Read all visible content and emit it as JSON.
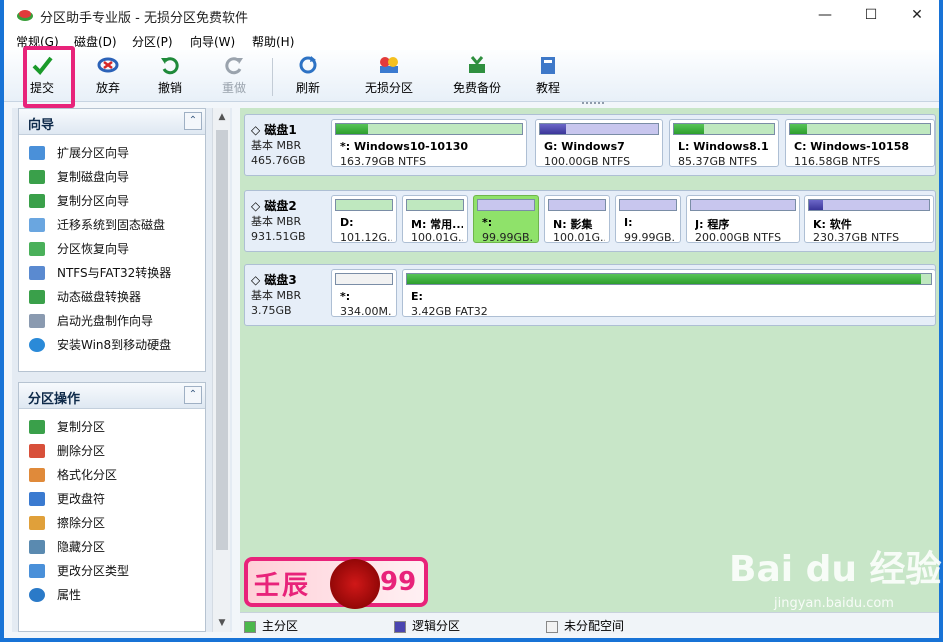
{
  "window": {
    "title": "分区助手专业版 - 无损分区免费软件",
    "minimize": "—",
    "maximize": "☐",
    "close": "✕"
  },
  "menu": [
    "常规(G)",
    "磁盘(D)",
    "分区(P)",
    "向导(W)",
    "帮助(H)"
  ],
  "toolbar": [
    {
      "label": "提交",
      "icon": "check-icon",
      "enabled": true
    },
    {
      "label": "放弃",
      "icon": "discard-icon",
      "enabled": true
    },
    {
      "label": "撤销",
      "icon": "undo-icon",
      "enabled": true
    },
    {
      "label": "重做",
      "icon": "redo-icon",
      "enabled": false
    },
    {
      "label": "刷新",
      "icon": "refresh-icon",
      "enabled": true
    },
    {
      "label": "无损分区",
      "icon": "partition-icon",
      "enabled": true
    },
    {
      "label": "免费备份",
      "icon": "backup-icon",
      "enabled": true
    },
    {
      "label": "教程",
      "icon": "tutorial-icon",
      "enabled": true
    }
  ],
  "wizard_panel": {
    "title": "向导",
    "items": [
      "扩展分区向导",
      "复制磁盘向导",
      "复制分区向导",
      "迁移系统到固态磁盘",
      "分区恢复向导",
      "NTFS与FAT32转换器",
      "动态磁盘转换器",
      "启动光盘制作向导",
      "安装Win8到移动硬盘"
    ]
  },
  "ops_panel": {
    "title": "分区操作",
    "items": [
      "复制分区",
      "删除分区",
      "格式化分区",
      "更改盘符",
      "擦除分区",
      "隐藏分区",
      "更改分区类型",
      "属性"
    ]
  },
  "disks": [
    {
      "name": "磁盘1",
      "type": "基本 MBR",
      "size": "465.76GB",
      "partitions": [
        {
          "name": "*: Windows10-10130",
          "size": "163.79GB NTFS",
          "kind": "primary",
          "used": 0.17
        },
        {
          "name": "G: Windows7",
          "size": "100.00GB NTFS",
          "kind": "logical",
          "used": 0.22
        },
        {
          "name": "L: Windows8.1",
          "size": "85.37GB NTFS",
          "kind": "primary",
          "used": 0.3
        },
        {
          "name": "C: Windows-10158",
          "size": "116.58GB NTFS",
          "kind": "primary",
          "used": 0.12
        }
      ]
    },
    {
      "name": "磁盘2",
      "type": "基本 MBR",
      "size": "931.51GB",
      "partitions": [
        {
          "name": "D:",
          "size": "101.12G...",
          "kind": "primary",
          "used": 0
        },
        {
          "name": "M: 常用...",
          "size": "100.01G...",
          "kind": "primary",
          "used": 0
        },
        {
          "name": "*:",
          "size": "99.99GB...",
          "kind": "logical",
          "used": 0,
          "selected": true
        },
        {
          "name": "N: 影集",
          "size": "100.01G...",
          "kind": "logical",
          "used": 0
        },
        {
          "name": "I:",
          "size": "99.99GB...",
          "kind": "logical",
          "used": 0
        },
        {
          "name": "J: 程序",
          "size": "200.00GB NTFS",
          "kind": "logical",
          "used": 0
        },
        {
          "name": "K: 软件",
          "size": "230.37GB NTFS",
          "kind": "logical",
          "used": 0.12
        }
      ]
    },
    {
      "name": "磁盘3",
      "type": "基本 MBR",
      "size": "3.75GB",
      "partitions": [
        {
          "name": "*:",
          "size": "334.00M...",
          "kind": "unallocated",
          "used": 0
        },
        {
          "name": "E:",
          "size": "3.42GB FAT32",
          "kind": "primary",
          "used": 0.98
        }
      ]
    }
  ],
  "legend": [
    {
      "label": "主分区",
      "color": "#4cb84c"
    },
    {
      "label": "逻辑分区",
      "color": "#4a45b0"
    },
    {
      "label": "未分配空间",
      "color": "#f2f2f2"
    }
  ],
  "stamp": {
    "left": "壬辰",
    "right": "99"
  },
  "watermark": {
    "brand": "Bai du 经验",
    "url": "jingyan.baidu.com"
  }
}
